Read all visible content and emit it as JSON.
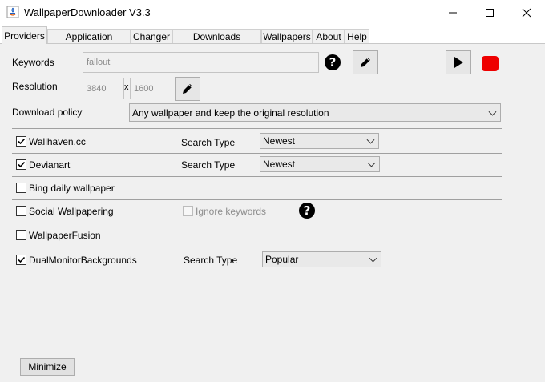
{
  "window": {
    "title": "WallpaperDownloader V3.3"
  },
  "tabs": [
    {
      "label": "Providers"
    },
    {
      "label": "Application Settings"
    },
    {
      "label": "Changer"
    },
    {
      "label": "Downloads Directory"
    },
    {
      "label": "Wallpapers"
    },
    {
      "label": "About"
    },
    {
      "label": "Help"
    }
  ],
  "keywords": {
    "label": "Keywords",
    "value": "fallout"
  },
  "resolution": {
    "label": "Resolution",
    "width": "3840",
    "separator": "x",
    "height": "1600"
  },
  "download_policy": {
    "label": "Download policy",
    "selected": "Any wallpaper and keep the original resolution"
  },
  "providers": [
    {
      "name": "Wallhaven.cc",
      "checked": true,
      "search_type_label": "Search Type",
      "search_type": "Newest"
    },
    {
      "name": "Devianart",
      "checked": true,
      "search_type_label": "Search Type",
      "search_type": "Newest"
    },
    {
      "name": "Bing daily wallpaper",
      "checked": false
    },
    {
      "name": "Social Wallpapering",
      "checked": false,
      "ignore_keywords_label": "Ignore keywords"
    },
    {
      "name": "WallpaperFusion",
      "checked": false
    },
    {
      "name": "DualMonitorBackgrounds",
      "checked": true,
      "search_type_label": "Search Type",
      "search_type": "Popular"
    }
  ],
  "help_glyph": "?",
  "footer": {
    "minimize_label": "Minimize"
  },
  "colors": {
    "stop": "#ee0000",
    "panel": "#f0f0f0"
  }
}
